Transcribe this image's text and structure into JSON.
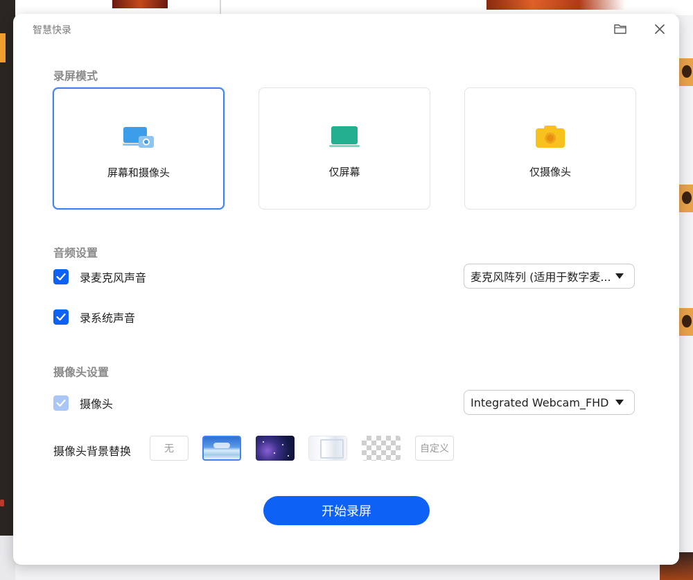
{
  "window": {
    "title": "智慧快录"
  },
  "icons": {
    "folder": "folder-icon",
    "close": "close-icon",
    "check": "checkmark-icon",
    "caret": "caret-down-icon"
  },
  "colors": {
    "accent": "#0d62f5",
    "selected_border": "#3f84f0",
    "checkbox_disabled": "#a9c6f7",
    "screen_camera_icon": "#3e9de8",
    "screen_icon": "#22b08f",
    "camera_icon": "#f7c21d"
  },
  "record_mode": {
    "title": "录屏模式",
    "options": [
      {
        "label": "屏幕和摄像头",
        "selected": true
      },
      {
        "label": "仅屏幕",
        "selected": false
      },
      {
        "label": "仅摄像头",
        "selected": false
      }
    ]
  },
  "audio": {
    "title": "音频设置",
    "mic": {
      "label": "录麦克风声音",
      "checked": true
    },
    "mic_device": "麦克风阵列 (适用于数字麦...",
    "system": {
      "label": "录系统声音",
      "checked": true
    }
  },
  "camera": {
    "title": "摄像头设置",
    "camera_toggle": {
      "label": "摄像头",
      "checked": true,
      "disabled": true
    },
    "camera_device": "Integrated Webcam_FHD",
    "background_label": "摄像头背景替换",
    "background_options": {
      "none": "无",
      "custom": "自定义"
    }
  },
  "start_button": "开始录屏"
}
